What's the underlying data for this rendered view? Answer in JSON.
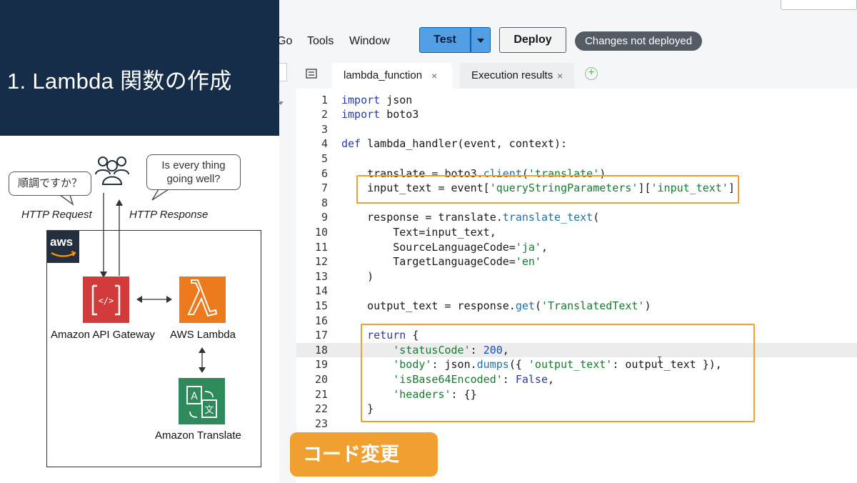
{
  "slide": {
    "title": "1.   Lambda 関数の作成"
  },
  "diagram": {
    "bubble_left": "順調ですか？",
    "bubble_right_line1": "Is every thing",
    "bubble_right_line2": "going well?",
    "http_request": "HTTP Request",
    "http_response": "HTTP Response",
    "aws_badge": "aws",
    "services": {
      "api_gateway": "Amazon API Gateway",
      "lambda": "AWS Lambda",
      "translate": "Amazon Translate"
    }
  },
  "menubar": {
    "go": "Go",
    "tools": "Tools",
    "window": "Window",
    "test": "Test",
    "deploy": "Deploy",
    "status": "Changes not deployed"
  },
  "tabs": [
    {
      "label": "lambda_function",
      "close": "×"
    },
    {
      "label": "Execution results",
      "close": "×"
    }
  ],
  "add_tab": "+",
  "code": [
    {
      "n": "1",
      "text": "import json"
    },
    {
      "n": "2",
      "text": "import boto3"
    },
    {
      "n": "3",
      "text": ""
    },
    {
      "n": "4",
      "text": "def lambda_handler(event, context):"
    },
    {
      "n": "5",
      "text": ""
    },
    {
      "n": "6",
      "text": "    translate = boto3.client('translate')"
    },
    {
      "n": "7",
      "text": "    input_text = event['queryStringParameters']['input_text']"
    },
    {
      "n": "8",
      "text": ""
    },
    {
      "n": "9",
      "text": "    response = translate.translate_text("
    },
    {
      "n": "10",
      "text": "        Text=input_text,"
    },
    {
      "n": "11",
      "text": "        SourceLanguageCode='ja',"
    },
    {
      "n": "12",
      "text": "        TargetLanguageCode='en'"
    },
    {
      "n": "13",
      "text": "    )"
    },
    {
      "n": "14",
      "text": ""
    },
    {
      "n": "15",
      "text": "    output_text = response.get('TranslatedText')"
    },
    {
      "n": "16",
      "text": ""
    },
    {
      "n": "17",
      "text": "    return {"
    },
    {
      "n": "18",
      "text": "        'statusCode': 200,"
    },
    {
      "n": "19",
      "text": "        'body': json.dumps({ 'output_text': output_text }),"
    },
    {
      "n": "20",
      "text": "        'isBase64Encoded': False,"
    },
    {
      "n": "21",
      "text": "        'headers': {}"
    },
    {
      "n": "22",
      "text": "    }"
    },
    {
      "n": "23",
      "text": ""
    }
  ],
  "active_line": 18,
  "callout": "コード変更",
  "colors": {
    "slide_banner": "#152d49",
    "test_button": "#539fe5",
    "status_badge": "#545b64",
    "highlight": "#f0a030",
    "api_gateway": "#d13b3b",
    "lambda": "#ec7a1c",
    "translate": "#2e8a5a"
  },
  "icons": [
    "users-icon",
    "api-gateway-icon",
    "lambda-icon",
    "translate-icon",
    "file-icon",
    "plus-icon"
  ]
}
